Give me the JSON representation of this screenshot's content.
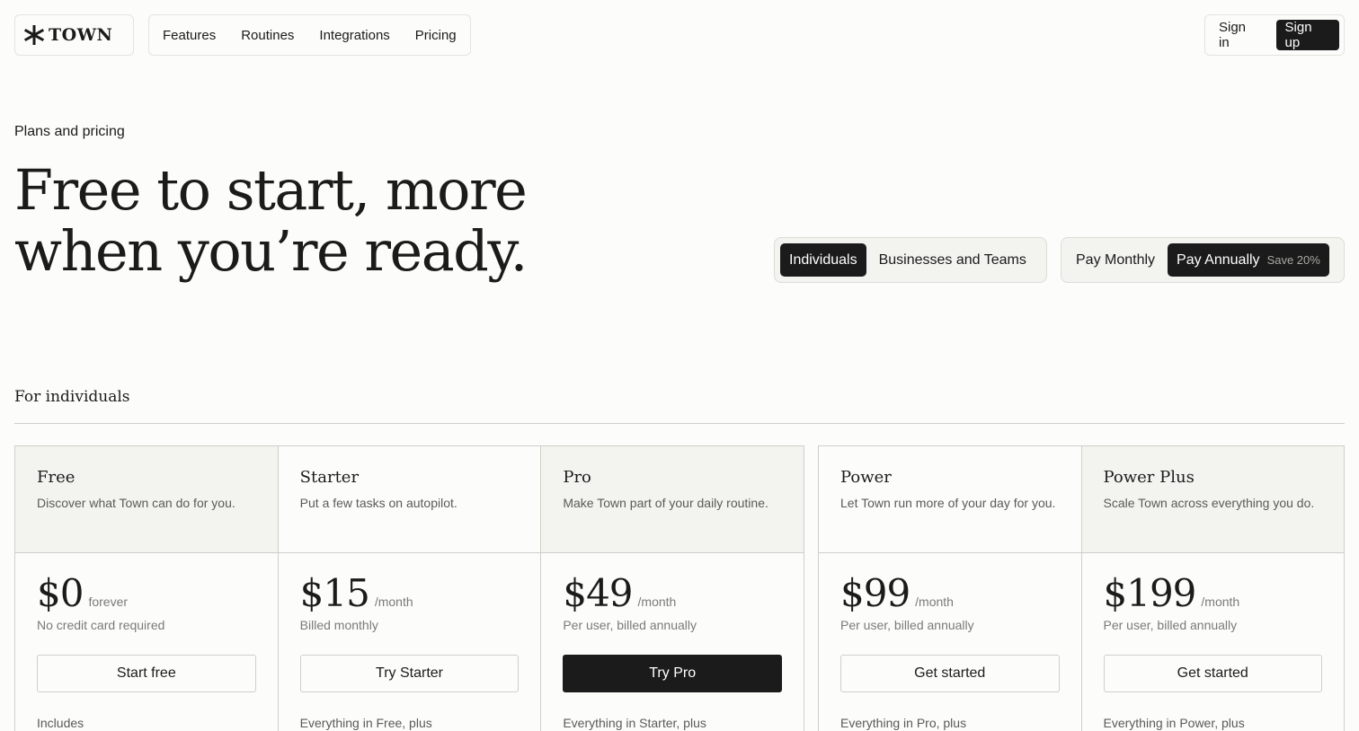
{
  "header": {
    "brand": "TOWN",
    "nav": [
      "Features",
      "Routines",
      "Integrations",
      "Pricing"
    ],
    "sign_in": "Sign in",
    "sign_up": "Sign up"
  },
  "hero": {
    "eyebrow": "Plans and pricing",
    "title": "Free to start, more when you’re ready."
  },
  "toggles": {
    "audience": {
      "active": "Individuals",
      "other": "Businesses and Teams"
    },
    "billing": {
      "monthly": "Pay Monthly",
      "annually": "Pay Annually",
      "save": "Save 20%"
    }
  },
  "section": {
    "title": "For individuals"
  },
  "plans": [
    {
      "name": "Free",
      "desc": "Discover what Town can do for you.",
      "price": "$0",
      "unit": "forever",
      "note": "No credit card required",
      "cta": "Start free",
      "includes": "Includes"
    },
    {
      "name": "Starter",
      "desc": "Put a few tasks on autopilot.",
      "price": "$15",
      "unit": "/month",
      "note": "Billed monthly",
      "cta": "Try Starter",
      "includes": "Everything in Free, plus"
    },
    {
      "name": "Pro",
      "desc": "Make Town part of your daily routine.",
      "price": "$49",
      "unit": "/month",
      "note": "Per user, billed annually",
      "cta": "Try Pro",
      "includes": "Everything in Starter, plus"
    },
    {
      "name": "Power",
      "desc": "Let Town run more of your day for you.",
      "price": "$99",
      "unit": "/month",
      "note": "Per user, billed annually",
      "cta": "Get started",
      "includes": "Everything in Pro, plus"
    },
    {
      "name": "Power Plus",
      "desc": "Scale Town across everything you do.",
      "price": "$199",
      "unit": "/month",
      "note": "Per user, billed annually",
      "cta": "Get started",
      "includes": "Everything in Power, plus"
    }
  ]
}
